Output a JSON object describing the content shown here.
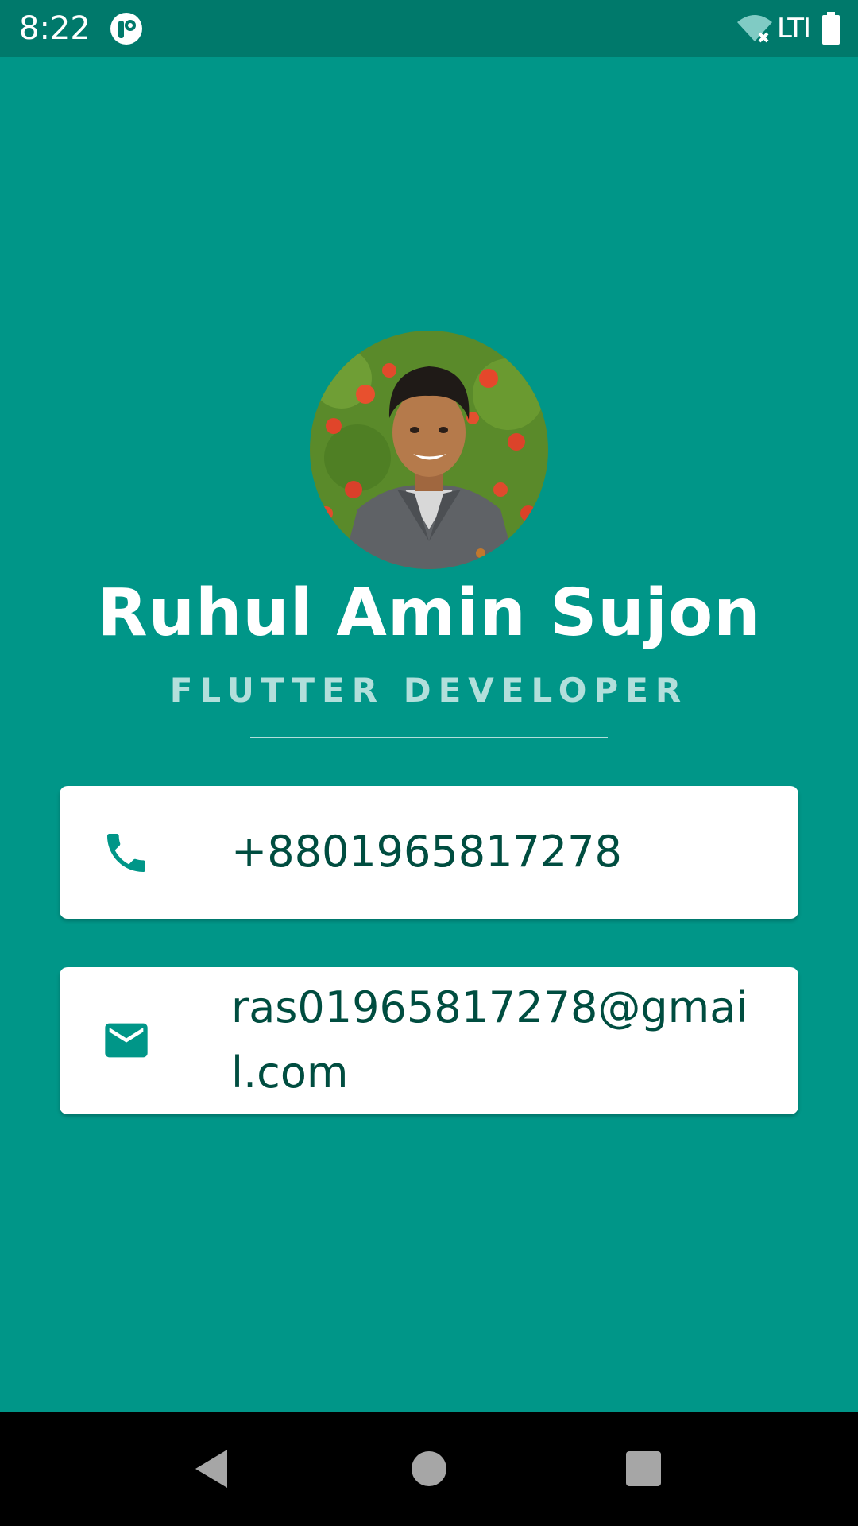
{
  "status_bar": {
    "time": "8:22",
    "network_label": "LTI",
    "icons": [
      "app-notification-icon",
      "wifi-off-icon",
      "battery-icon"
    ]
  },
  "profile": {
    "name": "Ruhul Amin Sujon",
    "title": "FLUTTER DEVELOPER"
  },
  "contacts": {
    "phone": {
      "icon": "phone-icon",
      "value": "+8801965817278"
    },
    "email": {
      "icon": "mail-icon",
      "value": "ras01965817278@gmail.com"
    }
  },
  "navigation": {
    "icons": [
      "back-icon",
      "home-icon",
      "recents-icon"
    ]
  },
  "colors": {
    "background": "#009688",
    "status_bar": "#00796B",
    "card": "#FFFFFF",
    "card_text": "#004D40",
    "accent_icon": "#009688",
    "title_text": "#B2DFDB"
  }
}
